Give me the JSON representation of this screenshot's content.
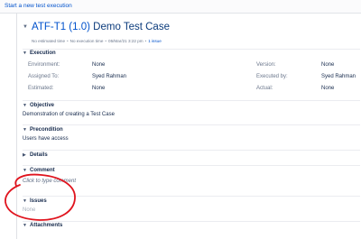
{
  "header": {
    "start_link": "Start a new test execution"
  },
  "test_case": {
    "key": "ATF-T1 (1.0)",
    "name": "Demo Test Case",
    "meta": {
      "estimated": "No estimated time",
      "execution_time": "No execution time",
      "date": "05/Mar/21 3:22 pm",
      "issues": "1 issue"
    }
  },
  "execution": {
    "title": "Execution",
    "environment_label": "Environment:",
    "environment_value": "None",
    "assigned_label": "Assigned To:",
    "assigned_value": "Syed Rahman",
    "estimated_label": "Estimated:",
    "estimated_value": "None",
    "version_label": "Version:",
    "version_value": "None",
    "executed_label": "Executed by:",
    "executed_value": "Syed Rahman",
    "actual_label": "Actual:",
    "actual_value": "None"
  },
  "objective": {
    "title": "Objective",
    "text": "Demonstration of creating a Test Case"
  },
  "precondition": {
    "title": "Precondition",
    "text": "Users have access"
  },
  "details": {
    "title": "Details"
  },
  "comment": {
    "title": "Comment",
    "placeholder": "Click to type comment"
  },
  "issues": {
    "title": "Issues",
    "value": "None"
  },
  "attachments": {
    "title": "Attachments"
  },
  "colors": {
    "link": "#0052cc",
    "annotation": "#e0141e"
  }
}
